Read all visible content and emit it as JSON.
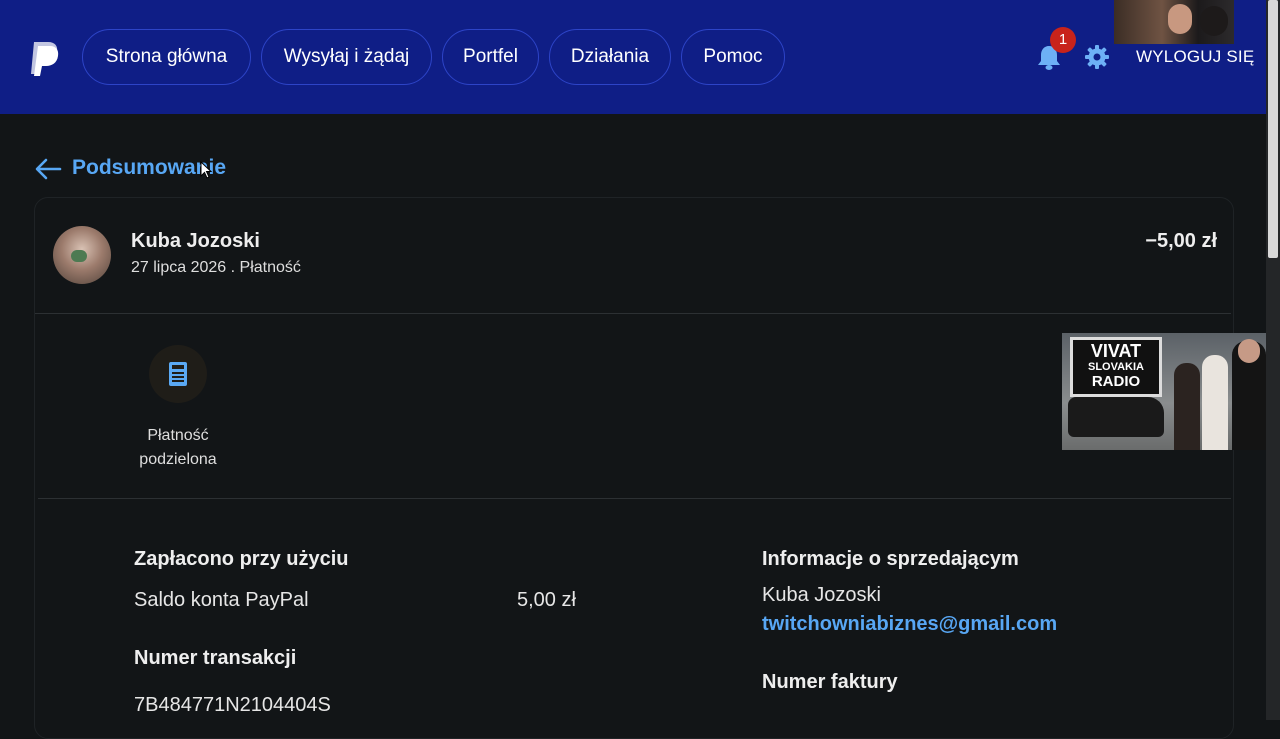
{
  "header": {
    "nav": [
      {
        "label": "Strona główna"
      },
      {
        "label": "Wysyłaj i żądaj"
      },
      {
        "label": "Portfel"
      },
      {
        "label": "Działania"
      },
      {
        "label": "Pomoc"
      }
    ],
    "notifications_count": "1",
    "logout_label": "WYLOGUJ SIĘ",
    "icons": [
      "paypal-logo",
      "bell-icon",
      "gear-icon"
    ],
    "colors": {
      "bar": "#0f1e86",
      "accent": "#58a7f4",
      "badge": "#c8231b"
    }
  },
  "page": {
    "back_title": "Podsumowanie"
  },
  "transaction": {
    "name": "Kuba Jozoski",
    "subline": "27 lipca 2026 . Płatność",
    "amount": "−5,00 zł",
    "split_label": "Płatność podzielona",
    "paid_with_heading": "Zapłacono przy użyciu",
    "paid_with_method": "Saldo konta PayPal",
    "paid_with_amount": "5,00 zł",
    "txn_number_heading": "Numer transakcji",
    "txn_number": "7B484771N2104404S",
    "seller_heading": "Informacje o sprzedającym",
    "seller_name": "Kuba Jozoski",
    "seller_email": "twitchowniabiznes@gmail.com",
    "invoice_heading": "Numer faktury"
  },
  "overlay": {
    "sign_line1": "VIVAT",
    "sign_line2": "SLOVAKIA",
    "sign_line3": "RADIO"
  }
}
